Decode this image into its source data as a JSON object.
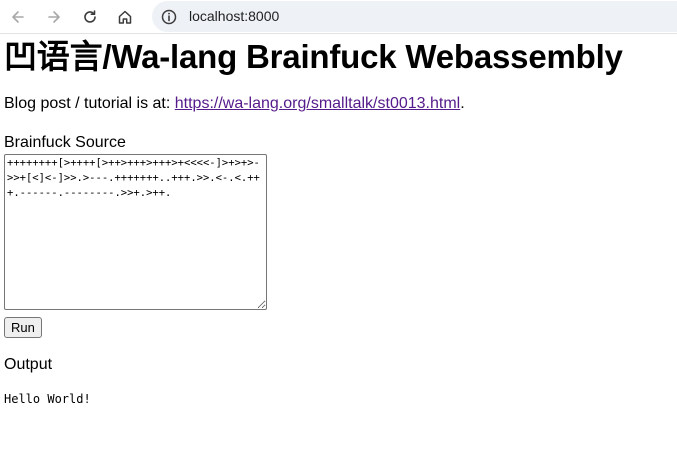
{
  "browser": {
    "url": "localhost:8000",
    "icons": {
      "back": "arrow-left-icon",
      "forward": "arrow-right-icon",
      "reload": "reload-icon",
      "home": "home-icon",
      "site_info": "info-circle-icon"
    }
  },
  "page": {
    "title": "凹语言/Wa-lang Brainfuck Webassembly",
    "blog_prefix": "Blog post / tutorial is at: ",
    "blog_link": "https://wa-lang.org/smalltalk/st0013.html",
    "blog_suffix": ".",
    "source_label": "Brainfuck Source",
    "source_code": "++++++++[>++++[>++>+++>+++>+<<<<-]>+>+>->>+[<]<-]>>.>---.+++++++..+++.>>.<-.<.+++.------.--------.>>+.>++.",
    "run_label": "Run",
    "output_label": "Output",
    "output_text": "Hello World!"
  },
  "colors": {
    "link_visited": "#551a8b",
    "omnibox_bg": "#eef1f6"
  }
}
